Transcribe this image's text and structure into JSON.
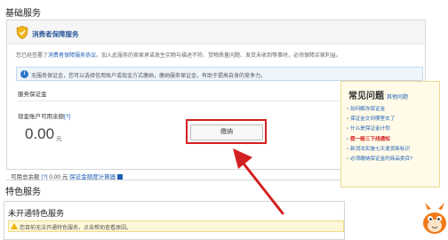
{
  "sections": {
    "basic": "基础服务",
    "feature": "特色服务"
  },
  "consumer_panel": {
    "title": "消费者保障服务",
    "agreement_prefix": "您已经签署了",
    "agreement_link": "消费者保障服务协议",
    "agreement_suffix": "。加入此服务的卖家承诺发生实物与描述不符、货物质量问题、发货未收到等事时，必须保障买家利益。",
    "info_text": "无服务保证金，您可以选择信用账户或现金方式缴纳，缴纳服务保证金，有助于提高自身的竞争力。",
    "deposit_title": "服务保证金",
    "cash_label": "现金账户可用余额",
    "help_q": "[?]",
    "amount": "0.00",
    "unit": "元",
    "pay_button": "缴纳",
    "footer_prefix": "可用总余额",
    "footer_q": "[?]",
    "footer_amount": "0.00 元",
    "footer_link": "保证金额度计算器"
  },
  "feature_panel": {
    "title": "未开通特色服务",
    "warning": "您目前无法开通特色服务，点击帮助查看原因。"
  },
  "faq": {
    "title": "常见问题",
    "more": "其他问题",
    "items": [
      {
        "label": "如何解冻保证金"
      },
      {
        "label": "保证金交到哪里去了"
      },
      {
        "label": "什么是保证金计划"
      },
      {
        "label": "假一赔三下线通知"
      },
      {
        "label": "新消法实施七天退货新标识"
      },
      {
        "label": "必须缴纳保证金的商品类目?"
      }
    ]
  },
  "colors": {
    "link": "#1f5fb5",
    "highlight": "#d32020",
    "faq_bg": "#fffbe8"
  }
}
